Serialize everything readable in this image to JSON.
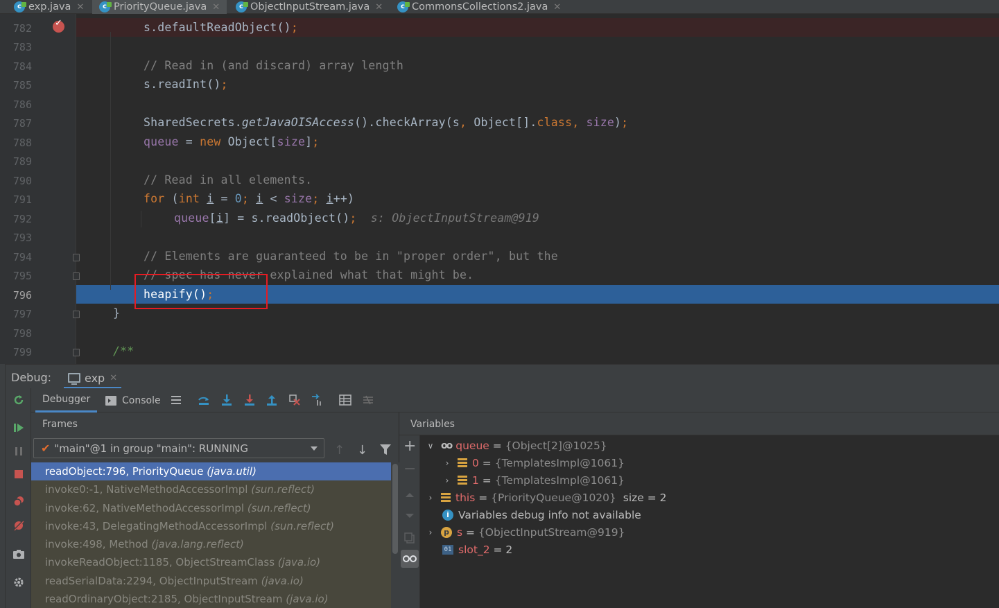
{
  "tabs": [
    {
      "label": "exp.java",
      "active": false
    },
    {
      "label": "PriorityQueue.java",
      "active": true
    },
    {
      "label": "ObjectInputStream.java",
      "active": false
    },
    {
      "label": "CommonsCollections2.java",
      "active": false
    }
  ],
  "editor": {
    "file": "PriorityQueue.java",
    "current_line": 796,
    "breakpoint_line": 782,
    "lines": [
      {
        "n": "782",
        "text": "s.defaultReadObject();"
      },
      {
        "n": "783",
        "text": ""
      },
      {
        "n": "784",
        "text": "// Read in (and discard) array length"
      },
      {
        "n": "785",
        "text": "s.readInt();"
      },
      {
        "n": "786",
        "text": ""
      },
      {
        "n": "787",
        "text": "SharedSecrets.getJavaOISAccess().checkArray(s, Object[].class, size);"
      },
      {
        "n": "788",
        "text": "queue = new Object[size];"
      },
      {
        "n": "789",
        "text": ""
      },
      {
        "n": "790",
        "text": "// Read in all elements."
      },
      {
        "n": "791",
        "text": "for (int i = 0; i < size; i++)"
      },
      {
        "n": "792",
        "text": "queue[i] = s.readObject();",
        "hint": "s: ObjectInputStream@919"
      },
      {
        "n": "793",
        "text": ""
      },
      {
        "n": "794",
        "text": "// Elements are guaranteed to be in \"proper order\", but the"
      },
      {
        "n": "795",
        "text": "// spec has never explained what that might be."
      },
      {
        "n": "796",
        "text": "heapify();"
      },
      {
        "n": "797",
        "text": "}"
      },
      {
        "n": "798",
        "text": ""
      },
      {
        "n": "799",
        "text": "/**"
      }
    ]
  },
  "debug": {
    "title": "Debug:",
    "session_tab": "exp",
    "tabs": {
      "debugger": "Debugger",
      "console": "Console"
    },
    "frames_label": "Frames",
    "variables_label": "Variables",
    "thread": "\"main\"@1 in group \"main\": RUNNING",
    "frames": [
      {
        "method": "readObject:796, PriorityQueue",
        "pkg": "(java.util)"
      },
      {
        "method": "invoke0:-1, NativeMethodAccessorImpl",
        "pkg": "(sun.reflect)"
      },
      {
        "method": "invoke:62, NativeMethodAccessorImpl",
        "pkg": "(sun.reflect)"
      },
      {
        "method": "invoke:43, DelegatingMethodAccessorImpl",
        "pkg": "(sun.reflect)"
      },
      {
        "method": "invoke:498, Method",
        "pkg": "(java.lang.reflect)"
      },
      {
        "method": "invokeReadObject:1185, ObjectStreamClass",
        "pkg": "(java.io)"
      },
      {
        "method": "readSerialData:2294, ObjectInputStream",
        "pkg": "(java.io)"
      },
      {
        "method": "readOrdinaryObject:2185, ObjectInputStream",
        "pkg": "(java.io)"
      }
    ],
    "variables": [
      {
        "name": "queue",
        "value": "{Object[2]@1025}",
        "extra": "",
        "icon": "watch-glasses-icon",
        "expanded": true
      },
      {
        "name": "0",
        "value": "{TemplatesImpl@1061}",
        "extra": "",
        "icon": "field-list-icon"
      },
      {
        "name": "1",
        "value": "{TemplatesImpl@1061}",
        "extra": "",
        "icon": "field-list-icon"
      },
      {
        "name": "this",
        "value": "{PriorityQueue@1020}",
        "extra": "size = 2",
        "icon": "field-list-icon"
      },
      {
        "name": "Variables debug info not available",
        "value": "",
        "extra": "",
        "icon": "info-icon"
      },
      {
        "name": "s",
        "value": "{ObjectInputStream@919}",
        "extra": "",
        "icon": "parameter-icon"
      },
      {
        "name": "slot_2",
        "value": "2",
        "extra": "",
        "icon": "primitive-icon"
      }
    ]
  }
}
